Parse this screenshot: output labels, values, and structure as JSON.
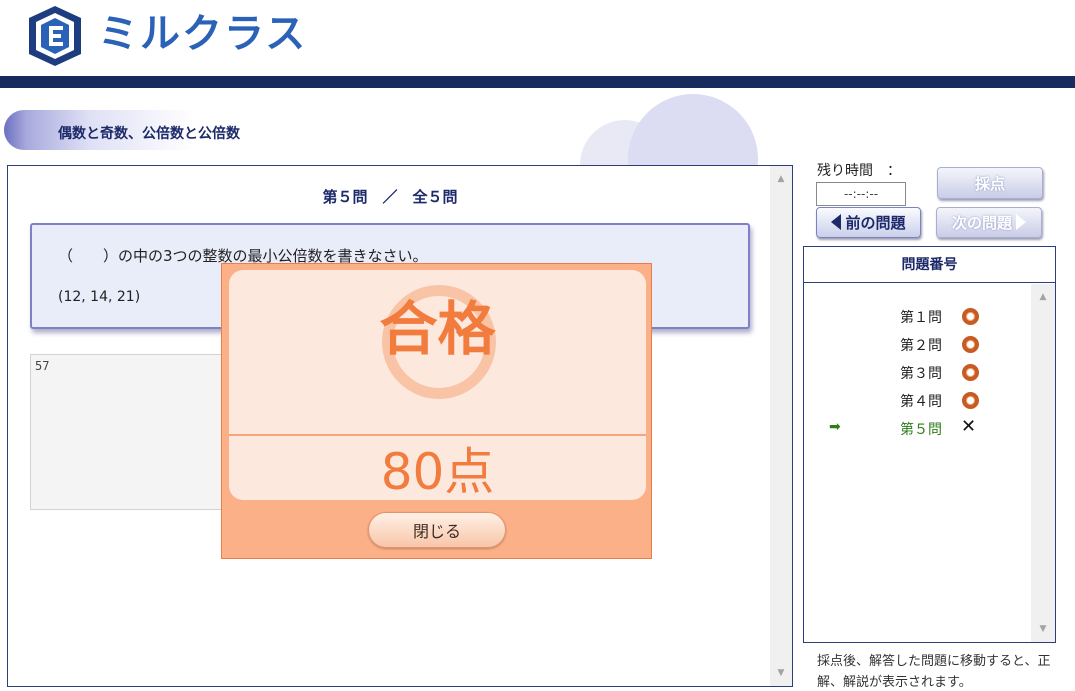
{
  "header": {
    "logo_text": "ミルクラス"
  },
  "title": "偶数と奇数、公倍数と公倍数",
  "question": {
    "count_label": "第５問　／　全５問",
    "text": "（　　）の中の3つの整数の最小公倍数を書きなさい。",
    "numbers": "(12, 14, 21)",
    "answer_value": "57"
  },
  "result": {
    "label": "合格",
    "score": "80点",
    "close_label": "閉じる"
  },
  "controls": {
    "time_label": "残り時間　：",
    "time_value": "--:--:--",
    "score_button": "採点",
    "prev_button": "前の問題",
    "next_button": "次の問題"
  },
  "question_list": {
    "header": "問題番号",
    "items": [
      {
        "label": "第１問",
        "status": "correct"
      },
      {
        "label": "第２問",
        "status": "correct"
      },
      {
        "label": "第３問",
        "status": "correct"
      },
      {
        "label": "第４問",
        "status": "correct"
      },
      {
        "label": "第５問",
        "status": "incorrect",
        "current": true
      }
    ]
  },
  "note": "採点後、解答した問題に移動すると、正解、解説が表示されます。",
  "colors": {
    "brand_blue": "#2a62b8",
    "header_bar": "#172b5e",
    "result_orange": "#f27b3e",
    "current_green": "#2e7d1a"
  }
}
